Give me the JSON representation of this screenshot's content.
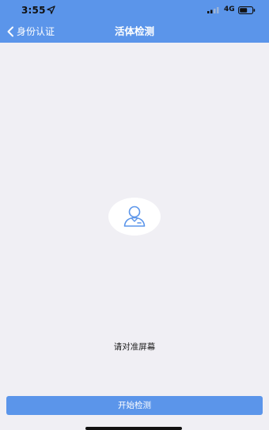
{
  "status_bar": {
    "time": "3:55",
    "network": "4G",
    "icons": [
      "location-arrow-icon",
      "signal-icon",
      "battery-icon"
    ]
  },
  "nav": {
    "back_label": "身份认证",
    "title": "活体检测",
    "back_icon": "chevron-left-icon"
  },
  "content": {
    "avatar_icon": "person-icon",
    "prompt": "请对准屏幕"
  },
  "footer": {
    "start_button_label": "开始检测"
  },
  "colors": {
    "accent": "#5b95ea",
    "background": "#f0eff4",
    "icon_stroke": "#5b95ea"
  }
}
